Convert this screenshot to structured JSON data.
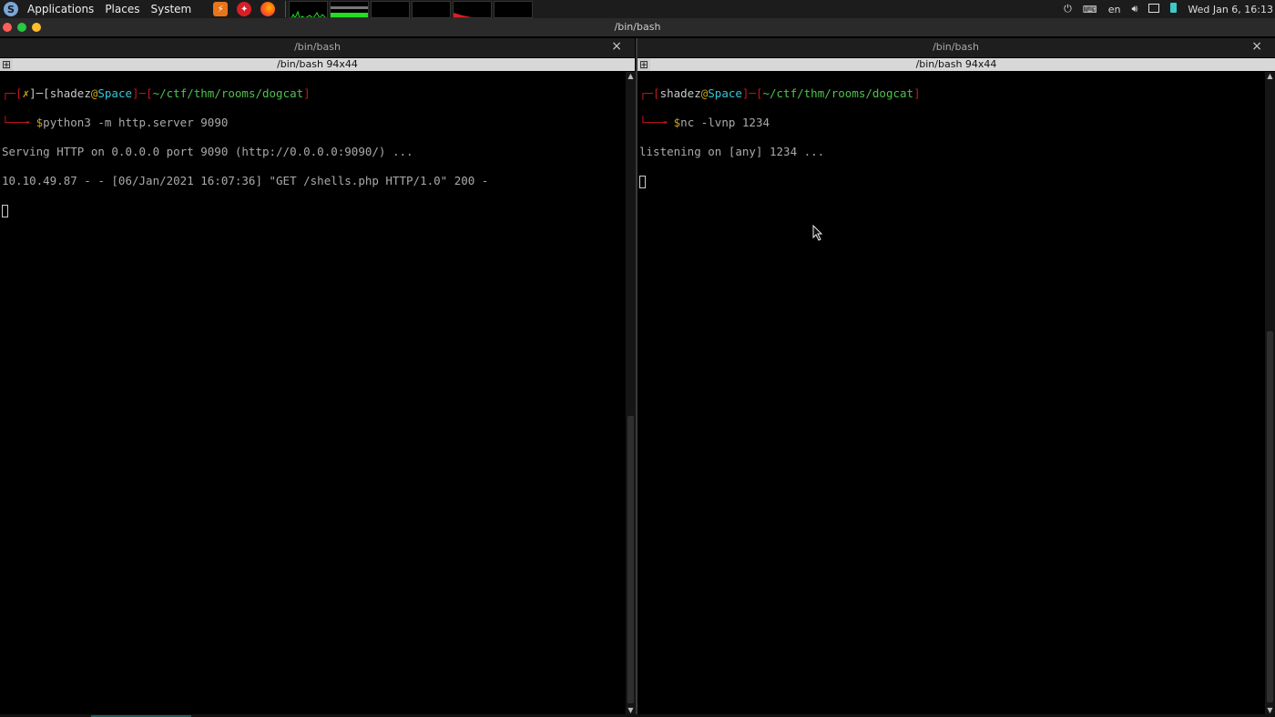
{
  "top_panel": {
    "menus": [
      "Applications",
      "Places",
      "System"
    ],
    "launchers": [
      {
        "icon": "burpsuite-icon"
      },
      {
        "icon": "red-app-icon"
      },
      {
        "icon": "firefox-icon"
      }
    ],
    "system_monitor_colors": {
      "cpu": "#22dd22",
      "net": "#d81f26"
    },
    "tray": {
      "power_icon": "power-icon",
      "keyboard_icon": "keyboard-icon",
      "language": "en",
      "volume_icon": "volume-icon",
      "display_icon": "display-icon",
      "battery_icon": "battery-icon",
      "clock": "Wed Jan 6, 16:13"
    }
  },
  "window": {
    "title": "/bin/bash",
    "buttons": [
      "close",
      "minimize",
      "maximize"
    ]
  },
  "tabs": [
    {
      "label": "/bin/bash",
      "close": "×"
    },
    {
      "label": "/bin/bash",
      "close": "×"
    }
  ],
  "panes": [
    {
      "header": "/bin/bash 94x44",
      "prompt": {
        "corner_top": "┌─[",
        "status": "✗",
        "mid": "]─[",
        "user": "shadez",
        "at": "@",
        "host": "Space",
        "mid2": "]─[",
        "path": "~/ctf/thm/rooms/dogcat",
        "end": "]",
        "corner_bottom": "└──╼ ",
        "dollar": "$",
        "command": "python3 -m http.server 9090"
      },
      "output": [
        "Serving HTTP on 0.0.0.0 port 9090 (http://0.0.0.0:9090/) ...",
        "10.10.49.87 - - [06/Jan/2021 16:07:36] \"GET /shells.php HTTP/1.0\" 200 -"
      ]
    },
    {
      "header": "/bin/bash 94x44",
      "prompt": {
        "corner_top": "┌─[",
        "user": "shadez",
        "at": "@",
        "host": "Space",
        "mid2": "]─[",
        "path": "~/ctf/thm/rooms/dogcat",
        "end": "]",
        "corner_bottom": "└──╼ ",
        "dollar": "$",
        "command": "nc -lvnp 1234"
      },
      "output": [
        "listening on [any] 1234 ..."
      ]
    }
  ]
}
